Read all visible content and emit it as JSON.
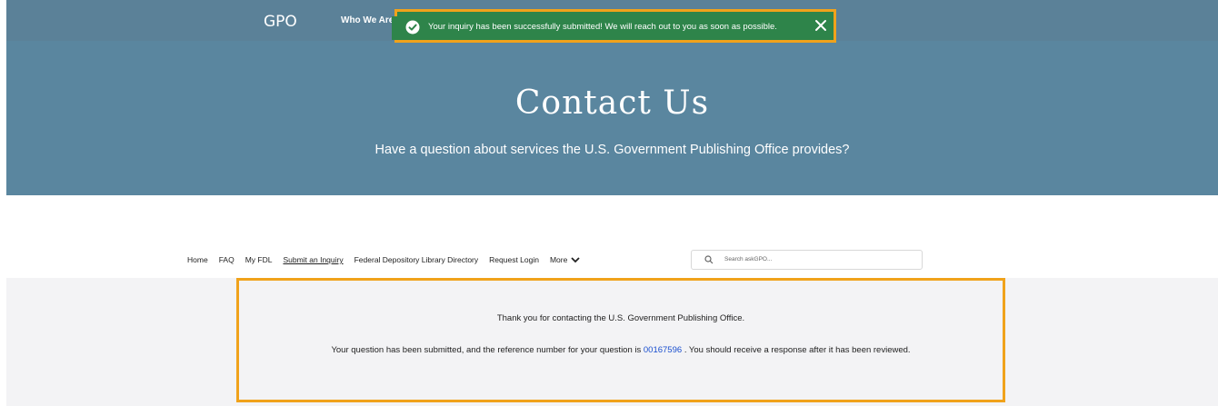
{
  "header": {
    "logo": "GPO",
    "nav_first": "Who We Are"
  },
  "toast": {
    "message": "Your inquiry has been successfully submitted! We will reach out to you as soon as possible.",
    "icon": "check-circle-icon",
    "close_icon": "close-icon"
  },
  "hero": {
    "title": "Contact Us",
    "subtitle": "Have a question about services the U.S. Government Publishing Office provides?"
  },
  "subnav": {
    "items": [
      "Home",
      "FAQ",
      "My FDL",
      "Submit an Inquiry",
      "Federal Depository Library Directory",
      "Request Login"
    ],
    "active": "Submit an Inquiry",
    "more_label": "More"
  },
  "search": {
    "placeholder": "Search askGPO..."
  },
  "confirmation": {
    "thanks": "Thank you for contacting the U.S. Government Publishing Office.",
    "pre": "Your question has been submitted, and the reference number for your question is",
    "reference": "00167596",
    "post": ". You should receive a response after it has been reviewed."
  },
  "colors": {
    "header_bg": "#5b8198",
    "hero_bg": "#5a869f",
    "toast_bg": "#2e844a",
    "highlight": "#f0a21b",
    "link": "#1a4fcf"
  }
}
